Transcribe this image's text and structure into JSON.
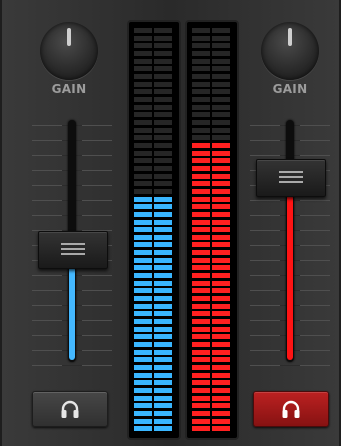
{
  "left_channel": {
    "gain_label": "GAIN",
    "volume_level": 0.46,
    "fill_color": "#44b8ff",
    "headphone_cue_active": false
  },
  "right_channel": {
    "gain_label": "GAIN",
    "volume_level": 0.81,
    "fill_color": "#ff1414",
    "headphone_cue_active": true
  },
  "meters": {
    "left": {
      "level": 0.59,
      "color": "#39b6ff"
    },
    "right": {
      "level": 0.72,
      "color": "#ff2020"
    },
    "total_segments": 53
  },
  "icons": {
    "knob": "knob-icon",
    "headphones": "headphones-icon"
  }
}
